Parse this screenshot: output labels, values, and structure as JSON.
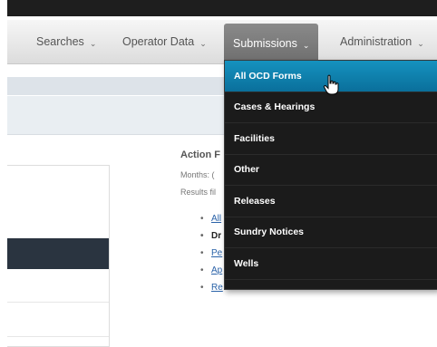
{
  "nav": {
    "items": [
      {
        "label": "Searches",
        "chevron": "⌄"
      },
      {
        "label": "Operator Data",
        "chevron": "⌄"
      },
      {
        "label": "Submissions",
        "chevron": "⌄",
        "active": true
      },
      {
        "label": "Administration",
        "chevron": "⌄"
      }
    ]
  },
  "dropdown": {
    "items": [
      {
        "label": "All OCD Forms",
        "highlighted": true
      },
      {
        "label": "Cases & Hearings"
      },
      {
        "label": "Facilities"
      },
      {
        "label": "Other"
      },
      {
        "label": "Releases"
      },
      {
        "label": "Sundry Notices"
      },
      {
        "label": "Wells"
      }
    ]
  },
  "action_filters": {
    "title": "Action F",
    "months": "Months: (",
    "results": "Results fil",
    "links": [
      "All",
      "Dr",
      "Pe",
      "Ap",
      "Re"
    ]
  },
  "colors": {
    "highlight": "#0f82b0",
    "menu_bg": "#1b1b1b",
    "active_tab": "#7d7d7d"
  }
}
